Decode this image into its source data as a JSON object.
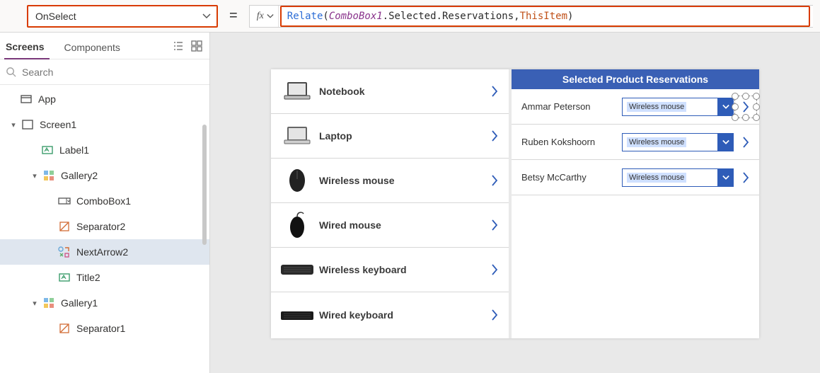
{
  "property_dropdown": {
    "value": "OnSelect"
  },
  "fx_label": "fx",
  "formula": {
    "func": "Relate",
    "open": "( ",
    "ident": "ComboBox1",
    "dot1": ".",
    "prop1": "Selected",
    "dot2": ".",
    "prop2": "Reservations",
    "comma": ", ",
    "this": "ThisItem",
    "close": " )"
  },
  "panel_tabs": {
    "screens": "Screens",
    "components": "Components"
  },
  "search": {
    "placeholder": "Search"
  },
  "tree": {
    "app": "App",
    "screen1": "Screen1",
    "label1": "Label1",
    "gallery2": "Gallery2",
    "combobox1": "ComboBox1",
    "separator2": "Separator2",
    "nextarrow2": "NextArrow2",
    "title2": "Title2",
    "gallery1": "Gallery1",
    "separator1": "Separator1"
  },
  "products": [
    {
      "name": "Notebook",
      "thumb": "laptop"
    },
    {
      "name": "Laptop",
      "thumb": "laptop"
    },
    {
      "name": "Wireless mouse",
      "thumb": "mouse"
    },
    {
      "name": "Wired mouse",
      "thumb": "mouse"
    },
    {
      "name": "Wireless keyboard",
      "thumb": "keyboard"
    },
    {
      "name": "Wired keyboard",
      "thumb": "keyboard"
    }
  ],
  "right_header": "Selected Product Reservations",
  "reservations": [
    {
      "name": "Ammar Peterson",
      "value": "Wireless mouse"
    },
    {
      "name": "Ruben Kokshoorn",
      "value": "Wireless mouse"
    },
    {
      "name": "Betsy McCarthy",
      "value": "Wireless mouse"
    }
  ]
}
